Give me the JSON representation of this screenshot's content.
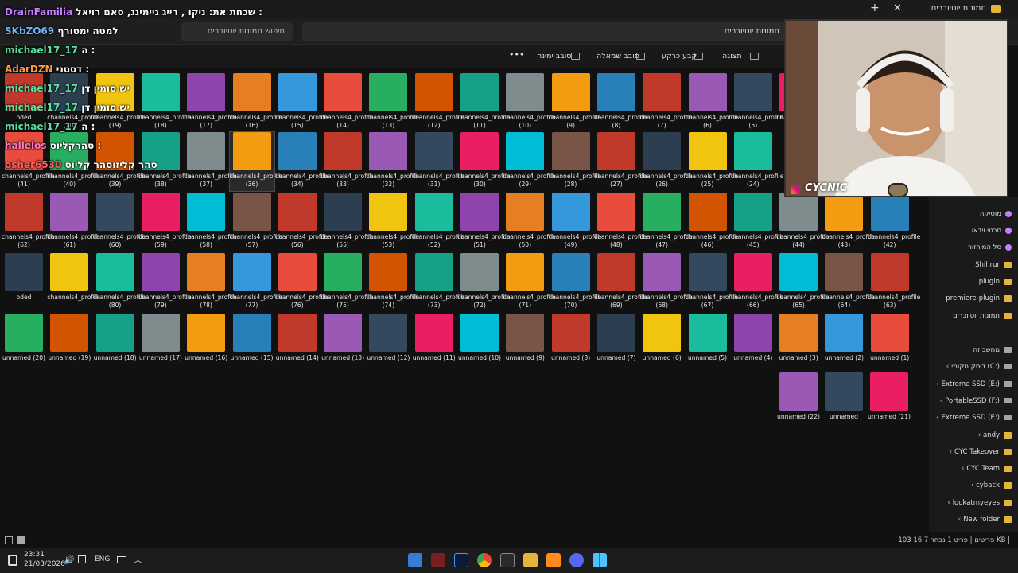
{
  "titlebar": {
    "tab_title": "תמונות יוטיוברים",
    "new_tab": "+",
    "close": "✕"
  },
  "address": {
    "search_placeholder": "חיפוש תמונות יוטיוברים",
    "path": "תמונות יוטיוברים"
  },
  "toolbar": {
    "more": "•••",
    "rotate_right": "סובב ימינה",
    "rotate_left": "סובב שמאלה",
    "set_background": "קבע כרקע",
    "view": "תצוגה"
  },
  "chat": {
    "line1_user": "DrainFamilia",
    "line1_text": "שכחת את: ניקו , רייג גיימינג, סאם רויאל :",
    "line2_user": "SKbZO69",
    "line2_text": "למטה ימטורף",
    "line3_user": "michael17_17",
    "line3_text": "ה :",
    "line4_user": "AdarDZN",
    "line4_text": "דסטני :",
    "line5_user": "michael17_17",
    "line5_text": "יש סומין דן",
    "line6_user": "michael17_17",
    "line6_text": "יש סומין דן",
    "line7_user": "michael17_17",
    "line7_text": "ה :",
    "line8_user": "hallelos",
    "line8_text": "סהרקליוס :",
    "line9_user": "osher6530",
    "line9_text": "סהר קליזוסהר קליוס"
  },
  "webcam": {
    "handle": "CYCNIC"
  },
  "grid": {
    "row1": [
      "oded",
      "channels4_profile (20)",
      "channels4_profile (19)",
      "channels4_profile (18)",
      "channels4_profile (17)",
      "channels4_profile (16)",
      "channels4_profile (15)",
      "channels4_profile (14)",
      "channels4_profile (13)",
      "channels4_profile (12)",
      "channels4_profile (11)",
      "channels4_profile (10)",
      "channels4_profile (9)",
      "channels4_profile (8)",
      "channels4_profile (7)",
      "channels4_profile (6)",
      "channels4_profile (5)",
      "channels4_profile (4)"
    ],
    "row2": [
      "channels4_profile (41)",
      "channels4_profile (40)",
      "channels4_profile (39)",
      "channels4_profile (38)",
      "channels4_profile (37)",
      "channels4_profile (36)",
      "channels4_profile (34)",
      "channels4_profile (33)",
      "channels4_profile (32)",
      "channels4_profile (31)",
      "channels4_profile (30)",
      "channels4_profile (29)",
      "channels4_profile (28)",
      "channels4_profile (27)",
      "channels4_profile (26)",
      "channels4_profile (25)",
      "channels4_profile (24)"
    ],
    "row3": [
      "channels4_profile (62)",
      "channels4_profile (61)",
      "channels4_profile (60)",
      "channels4_profile (59)",
      "channels4_profile (58)",
      "channels4_profile (57)",
      "channels4_profile (56)",
      "channels4_profile (55)",
      "channels4_profile (53)",
      "channels4_profile (52)",
      "channels4_profile (51)",
      "channels4_profile (50)",
      "channels4_profile (49)",
      "channels4_profile (48)",
      "channels4_profile (47)",
      "channels4_profile (46)",
      "channels4_profile (45)",
      "channels4_profile (44)",
      "channels4_profile (43)",
      "channels4_profile (42)"
    ],
    "row4": [
      "oded",
      "channels4_profile",
      "channels4_profile (80)",
      "channels4_profile (79)",
      "channels4_profile (78)",
      "channels4_profile (77)",
      "channels4_profile (76)",
      "channels4_profile (75)",
      "channels4_profile (74)",
      "channels4_profile (73)",
      "channels4_profile (72)",
      "channels4_profile (71)",
      "channels4_profile (70)",
      "channels4_profile (69)",
      "channels4_profile (68)",
      "channels4_profile (67)",
      "channels4_profile (66)",
      "channels4_profile (65)",
      "channels4_profile (64)",
      "channels4_profile (63)"
    ],
    "row5": [
      "unnamed (20)",
      "unnamed (19)",
      "unnamed (18)",
      "unnamed (17)",
      "unnamed (16)",
      "unnamed (15)",
      "unnamed (14)",
      "unnamed (13)",
      "unnamed (12)",
      "unnamed (11)",
      "unnamed (10)",
      "unnamed (9)",
      "unnamed (8)",
      "unnamed (7)",
      "unnamed (6)",
      "unnamed (5)",
      "unnamed (4)",
      "unnamed (3)",
      "unnamed (2)",
      "unnamed (1)"
    ],
    "row6": [
      "unnamed (22)",
      "unnamed",
      "unnamed (21)"
    ]
  },
  "sidebar": {
    "items": [
      {
        "label": "מוסיקה",
        "kind": "pin"
      },
      {
        "label": "סרטי וידאו",
        "kind": "pin"
      },
      {
        "label": "סל המיחזור",
        "kind": "pin"
      },
      {
        "label": "Shihrur",
        "kind": "folder"
      },
      {
        "label": "plugin",
        "kind": "folder"
      },
      {
        "label": "premiere-plugin",
        "kind": "folder"
      },
      {
        "label": "תמונות יוטיוברים",
        "kind": "folder"
      },
      {
        "label": "מחשב זה",
        "kind": "pc"
      },
      {
        "label": "דיסק מקומי (C:)",
        "kind": "drive"
      },
      {
        "label": "Extreme SSD (E:)",
        "kind": "drive"
      },
      {
        "label": "PortableSSD (F:)",
        "kind": "drive"
      },
      {
        "label": "Extreme SSD (E:)",
        "kind": "drive"
      },
      {
        "label": "andy",
        "kind": "folder"
      },
      {
        "label": "CYC Takeover",
        "kind": "folder"
      },
      {
        "label": "CYC Team",
        "kind": "folder"
      },
      {
        "label": "cyback",
        "kind": "folder"
      },
      {
        "label": "lookatmyeyes",
        "kind": "folder"
      },
      {
        "label": "New folder",
        "kind": "folder"
      }
    ]
  },
  "status": {
    "text": "103 פריטים  |  פריט 1 נבחר  16.7 KB  |"
  },
  "taskbar": {
    "time": "23:31",
    "date": "21/03/2026",
    "lang": "ENG"
  }
}
